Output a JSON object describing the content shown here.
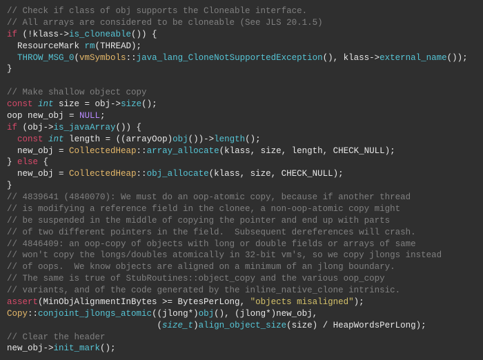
{
  "code": {
    "c1": "// Check if class of obj supports the Cloneable interface.",
    "c2": "// All arrays are considered to be cloneable (See JLS 20.1.5)",
    "l3_if": "if",
    "l3_a": " (!klass->",
    "l3_fn": "is_cloneable",
    "l3_b": "()) {",
    "l4_a": "  ResourceMark ",
    "l4_fn": "rm",
    "l4_b": "(THREAD);",
    "l5_a": "  ",
    "l5_fn1": "THROW_MSG_0",
    "l5_b": "(",
    "l5_cls": "vmSymbols",
    "l5_c": "::",
    "l5_fn2": "java_lang_CloneNotSupportedException",
    "l5_d": "(), klass->",
    "l5_fn3": "external_name",
    "l5_e": "());",
    "l6": "}",
    "c7": "// Make shallow object copy",
    "l8_const": "const",
    "l8_int": "int",
    "l8_a": " size = obj->",
    "l8_fn": "size",
    "l8_b": "();",
    "l9_a": "oop new_obj = ",
    "l9_null": "NULL",
    "l9_b": ";",
    "l10_if": "if",
    "l10_a": " (obj->",
    "l10_fn": "is_javaArray",
    "l10_b": "()) {",
    "l11_pad": "  ",
    "l11_const": "const",
    "l11_int": "int",
    "l11_a": " length = ((arrayOop)",
    "l11_fn1": "obj",
    "l11_b": "())->",
    "l11_fn2": "length",
    "l11_c": "();",
    "l12_a": "  new_obj = ",
    "l12_cls": "CollectedHeap",
    "l12_b": "::",
    "l12_fn": "array_allocate",
    "l12_c": "(klass, size, length, CHECK_NULL);",
    "l13_a": "} ",
    "l13_else": "else",
    "l13_b": " {",
    "l14_a": "  new_obj = ",
    "l14_cls": "CollectedHeap",
    "l14_b": "::",
    "l14_fn": "obj_allocate",
    "l14_c": "(klass, size, CHECK_NULL);",
    "l15": "}",
    "c16": "// 4839641 (4840070): We must do an oop-atomic copy, because if another thread",
    "c17": "// is modifying a reference field in the clonee, a non-oop-atomic copy might",
    "c18": "// be suspended in the middle of copying the pointer and end up with parts",
    "c19": "// of two different pointers in the field.  Subsequent dereferences will crash.",
    "c20": "// 4846409: an oop-copy of objects with long or double fields or arrays of same",
    "c21": "// won't copy the longs/doubles atomically in 32-bit vm's, so we copy jlongs instead",
    "c22": "// of oops.  We know objects are aligned on a minimum of an jlong boundary.",
    "c23": "// The same is true of StubRoutines::object_copy and the various oop_copy",
    "c24": "// variants, and of the code generated by the inline_native_clone intrinsic.",
    "l25_assert": "assert",
    "l25_a": "(MinObjAlignmentInBytes >= BytesPerLong, ",
    "l25_str": "\"objects misaligned\"",
    "l25_b": ");",
    "l26_cls": "Copy",
    "l26_a": "::",
    "l26_fn": "conjoint_jlongs_atomic",
    "l26_b": "((jlong*)",
    "l26_fn2": "obj",
    "l26_c": "(), (jlong*)new_obj,",
    "l27_pad": "                             (",
    "l27_type": "size_t",
    "l27_a": ")",
    "l27_fn": "align_object_size",
    "l27_b": "(size) / HeapWordsPerLong);",
    "c28": "// Clear the header",
    "l29_a": "new_obj->",
    "l29_fn": "init_mark",
    "l29_b": "();"
  }
}
